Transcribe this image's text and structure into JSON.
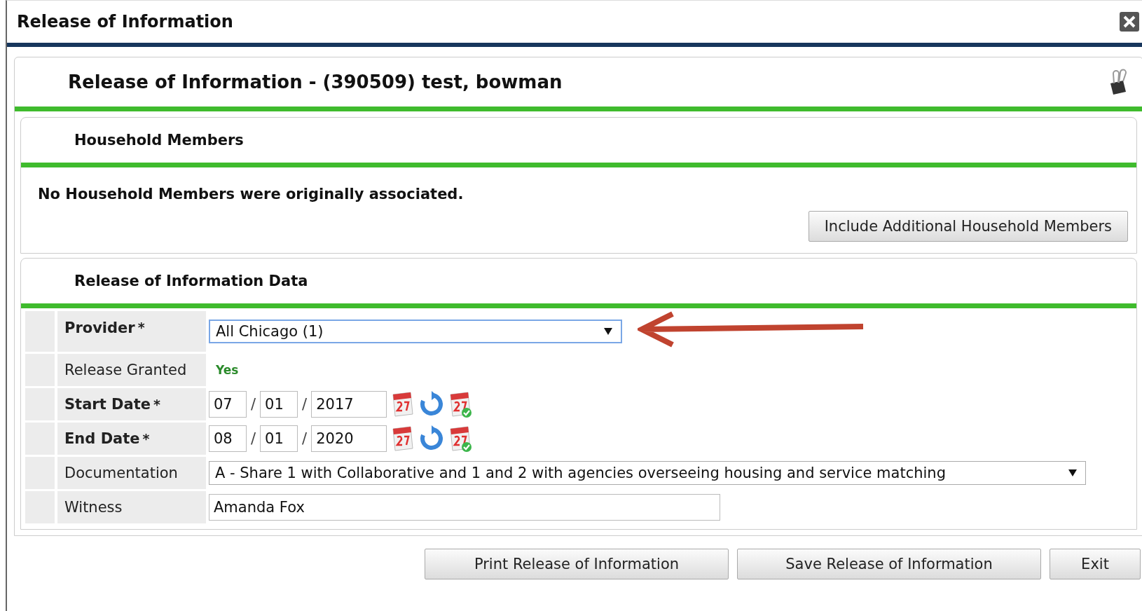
{
  "window": {
    "title": "Release of Information"
  },
  "header": {
    "title": "Release of Information - (390509) test, bowman"
  },
  "household": {
    "title": "Household Members",
    "message": "No Household Members were originally associated.",
    "button": "Include Additional Household Members"
  },
  "data_section": {
    "title": "Release of Information Data",
    "required_mark": "*",
    "date_separator": "/",
    "fields": [
      {
        "kind": "select",
        "label": "Provider",
        "required": true,
        "value": "All Chicago (1)",
        "focused": true
      },
      {
        "kind": "status",
        "label": "Release Granted",
        "required": false,
        "value": "Yes"
      },
      {
        "kind": "date",
        "label": "Start Date",
        "required": true,
        "month": "07",
        "day": "01",
        "year": "2017"
      },
      {
        "kind": "date",
        "label": "End Date",
        "required": true,
        "month": "08",
        "day": "01",
        "year": "2020"
      },
      {
        "kind": "select",
        "label": "Documentation",
        "required": false,
        "value": "A - Share 1 with Collaborative and 1 and 2 with agencies overseeing housing and service matching",
        "focused": false
      },
      {
        "kind": "input",
        "label": "Witness",
        "required": false,
        "value": "Amanda Fox"
      }
    ]
  },
  "buttons": [
    "Print Release of Information",
    "Save Release of Information",
    "Exit"
  ]
}
